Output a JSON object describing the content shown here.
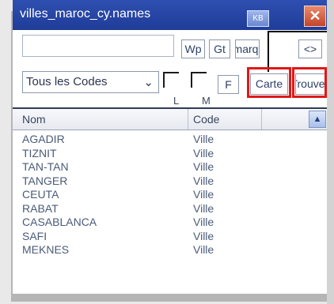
{
  "window": {
    "title": "villes_maroc_cy.names",
    "kb_label": "KB",
    "close_label": "✕"
  },
  "toolbar": {
    "search_value": "",
    "wp_label": "Wp",
    "gt_label": "Gt",
    "marq_label": "marq",
    "nav_label": "<>",
    "filter_value": "Tous les Codes",
    "filter_arrow": "⌄",
    "check_l_label": "L",
    "check_m_label": "M",
    "f_label": "F",
    "carte_label": "Carte",
    "trouve_label": "Trouve"
  },
  "table": {
    "columns": [
      "Nom",
      "Code"
    ],
    "scroll_up_icon": "▲",
    "rows": [
      {
        "nom": "AGADIR",
        "code": "Ville"
      },
      {
        "nom": "TIZNIT",
        "code": "Ville"
      },
      {
        "nom": "TAN-TAN",
        "code": "Ville"
      },
      {
        "nom": "TANGER",
        "code": "Ville"
      },
      {
        "nom": "CEUTA",
        "code": "Ville"
      },
      {
        "nom": "RABAT",
        "code": "Ville"
      },
      {
        "nom": "CASABLANCA",
        "code": "Ville"
      },
      {
        "nom": "SAFI",
        "code": "Ville"
      },
      {
        "nom": "MEKNES",
        "code": "Ville"
      }
    ]
  },
  "colors": {
    "titlebar": "#2f4fb0",
    "highlight": "#e01818",
    "text": "#4b5b78"
  }
}
